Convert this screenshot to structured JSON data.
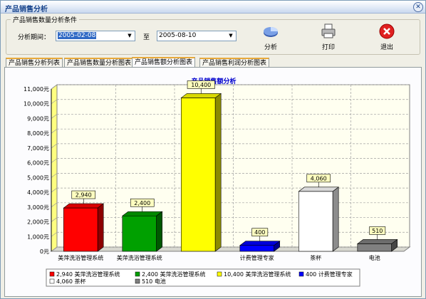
{
  "window": {
    "title": "产品销售分析"
  },
  "criteria": {
    "legend": "产品销售数量分析条件",
    "period_label": "分析期间：",
    "start_date": "2005-02-08",
    "to_label": "至",
    "end_date": "2005-08-10"
  },
  "toolbar": {
    "analyze_label": "分析",
    "print_label": "打印",
    "exit_label": "退出"
  },
  "tabs": [
    {
      "label": "产品销售分析列表"
    },
    {
      "label": "产品销售数量分析图表"
    },
    {
      "label": "产品销售额分析图表"
    },
    {
      "label": "产品销售利润分析图表"
    }
  ],
  "active_tab": 2,
  "colors": {
    "title_bar_text": "#15428b",
    "chart_title": "#0000cc",
    "grid": "#a0a0a0",
    "wall": "#fffff0"
  },
  "chart_data": {
    "type": "bar",
    "title": "产品销售额分析",
    "ylim": [
      0,
      11000
    ],
    "yticks": [
      "0元",
      "1,000元",
      "2,000元",
      "3,000元",
      "4,000元",
      "5,000元",
      "6,000元",
      "7,000元",
      "8,000元",
      "9,000元",
      "10,000元",
      "11,000元"
    ],
    "categories": [
      "美萍洗浴管理系统",
      "美萍洗浴管理系统",
      "",
      "计费管理专家",
      "茶杯",
      "电池"
    ],
    "values": [
      2940,
      2400,
      10400,
      400,
      4060,
      510
    ],
    "data_labels": [
      "2,940",
      "2,400",
      "10,400",
      "400",
      "4,060",
      "510"
    ],
    "bar_colors": [
      "#ff0000",
      "#00a000",
      "#ffff00",
      "#0000ff",
      "#ffffff",
      "#808080"
    ],
    "legend": [
      "2,940 美萍洗浴管理系统",
      "2,400 美萍洗浴管理系统",
      "10,400 美萍洗浴管理系统",
      "400 计费管理专家",
      "4,060 茶杯",
      "510 电池"
    ],
    "grid": true,
    "legend_position": "bottom"
  }
}
